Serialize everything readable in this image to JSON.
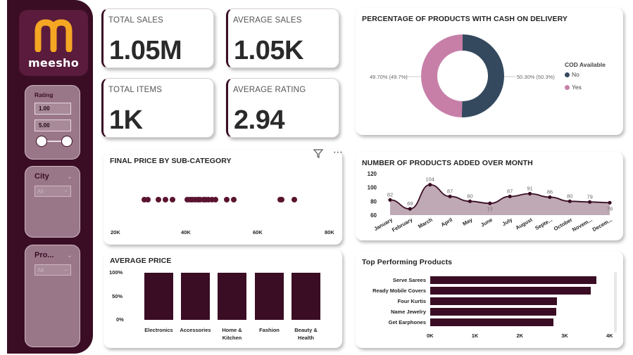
{
  "brand": {
    "name": "meesho",
    "colors": {
      "primary": "#3a0d24",
      "logo_orange": "#f5a623",
      "cod_no": "#34495e",
      "cod_yes": "#c77fa8"
    }
  },
  "filters": {
    "rating": {
      "label": "Rating",
      "min": "1.00",
      "max": "5.00"
    },
    "city": {
      "label": "City",
      "value": "All"
    },
    "product": {
      "label": "Pro...",
      "value": "All"
    }
  },
  "kpis": {
    "total_sales": {
      "label": "TOTAL SALES",
      "value": "1.05M"
    },
    "average_sales": {
      "label": "AVERAGE SALES",
      "value": "1.05K"
    },
    "total_items": {
      "label": "TOTAL ITEMS",
      "value": "1K"
    },
    "average_rating": {
      "label": "AVERAGE RATING",
      "value": "2.94"
    }
  },
  "icons": {
    "filter": "filter-icon",
    "more": "more-options-icon"
  },
  "chart_data": [
    {
      "type": "pie",
      "title": "PERCENTAGE OF PRODUCTS WITH CASH ON DELIVERY",
      "legend_title": "COD Available",
      "legend_position": "right",
      "categories": [
        "No",
        "Yes"
      ],
      "values": [
        50.3,
        49.7
      ],
      "labels": [
        "50.30% (50.3%)",
        "49.70% (49.7%)"
      ]
    },
    {
      "type": "scatter",
      "title": "FINAL PRICE BY SUB-CATEGORY",
      "xlim": [
        20000,
        80000
      ],
      "xticks": [
        "20K",
        "40K",
        "60K",
        "80K"
      ],
      "x": [
        28000,
        29000,
        32000,
        34000,
        36000,
        40000,
        40800,
        41500,
        42200,
        43000,
        43700,
        44500,
        45200,
        46000,
        47000,
        48000,
        51000,
        53000,
        66000,
        66500,
        70000
      ]
    },
    {
      "type": "area",
      "title": "NUMBER OF PRODUCTS ADDED OVER MONTH",
      "categories": [
        "January",
        "February",
        "March",
        "April",
        "May",
        "June",
        "July",
        "August",
        "Septe...",
        "October",
        "Novem...",
        "Decem..."
      ],
      "values": [
        82,
        69,
        104,
        87,
        80,
        77,
        87,
        91,
        86,
        80,
        79,
        78
      ],
      "ylim": [
        60,
        120
      ],
      "yticks": [
        "120",
        "100",
        "80",
        "60"
      ]
    },
    {
      "type": "bar",
      "title": "AVERAGE PRICE",
      "categories": [
        "Electronics",
        "Accessories",
        "Home & Kitchen",
        "Fashion",
        "Beauty & Health"
      ],
      "values": [
        100,
        100,
        100,
        100,
        100
      ],
      "ylim": [
        0,
        100
      ],
      "yticks": [
        "100%",
        "50%",
        "0%"
      ]
    },
    {
      "type": "bar",
      "orientation": "horizontal",
      "title": "Top Performing Products",
      "categories": [
        "Serve Sarees",
        "Ready Mobile Covers",
        "Four Kurtis",
        "Name Jewelry",
        "Get Earphones"
      ],
      "values": [
        3700,
        3580,
        2830,
        2800,
        2750
      ],
      "xlim": [
        0,
        4000
      ],
      "xticks": [
        "0K",
        "1K",
        "2K",
        "3K",
        "4K"
      ]
    }
  ]
}
